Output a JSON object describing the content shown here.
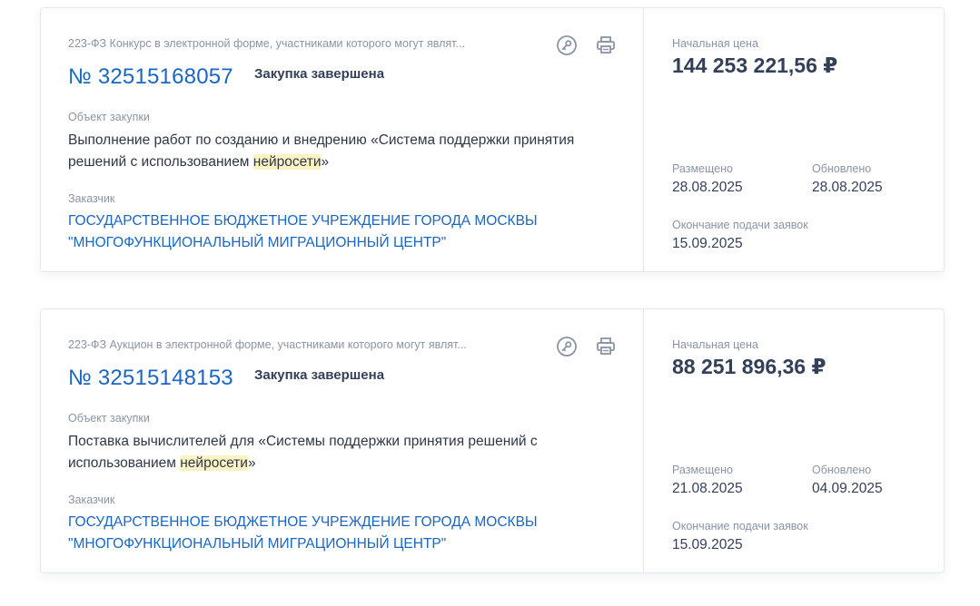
{
  "cards": [
    {
      "law_type": "223-ФЗ Конкурс в электронной форме, участниками которого могут являт...",
      "number": "№ 32515168057",
      "status": "Закупка завершена",
      "object_label": "Объект закупки",
      "object_before": "Выполнение работ по созданию и внедрению «Система поддержки принятия решений с использованием ",
      "object_highlight": "нейросети",
      "object_after": "»",
      "customer_label": "Заказчик",
      "customer": "ГОСУДАРСТВЕННОЕ БЮДЖЕТНОЕ УЧРЕЖДЕНИЕ ГОРОДА МОСКВЫ \"МНОГОФУНКЦИОНАЛЬНЫЙ МИГРАЦИОННЫЙ ЦЕНТР\"",
      "price_label": "Начальная цена",
      "price": "144 253 221,56 ₽",
      "posted_label": "Размещено",
      "posted": "28.08.2025",
      "updated_label": "Обновлено",
      "updated": "28.08.2025",
      "deadline_label": "Окончание подачи заявок",
      "deadline": "15.09.2025"
    },
    {
      "law_type": "223-ФЗ Аукцион в электронной форме, участниками которого могут являт...",
      "number": "№ 32515148153",
      "status": "Закупка завершена",
      "object_label": "Объект закупки",
      "object_before": "Поставка вычислителей для «Системы поддержки принятия решений с использованием ",
      "object_highlight": "нейросети",
      "object_after": "»",
      "customer_label": "Заказчик",
      "customer": "ГОСУДАРСТВЕННОЕ БЮДЖЕТНОЕ УЧРЕЖДЕНИЕ ГОРОДА МОСКВЫ \"МНОГОФУНКЦИОНАЛЬНЫЙ МИГРАЦИОННЫЙ ЦЕНТР\"",
      "price_label": "Начальная цена",
      "price": "88 251 896,36 ₽",
      "posted_label": "Размещено",
      "posted": "21.08.2025",
      "updated_label": "Обновлено",
      "updated": "04.09.2025",
      "deadline_label": "Окончание подачи заявок",
      "deadline": "15.09.2025"
    }
  ],
  "icons": {
    "key": "key-icon",
    "print": "print-icon"
  },
  "colors": {
    "link": "#1a66c5",
    "highlight": "#fcf3c4",
    "muted": "#8a94a6",
    "text": "#334059"
  }
}
